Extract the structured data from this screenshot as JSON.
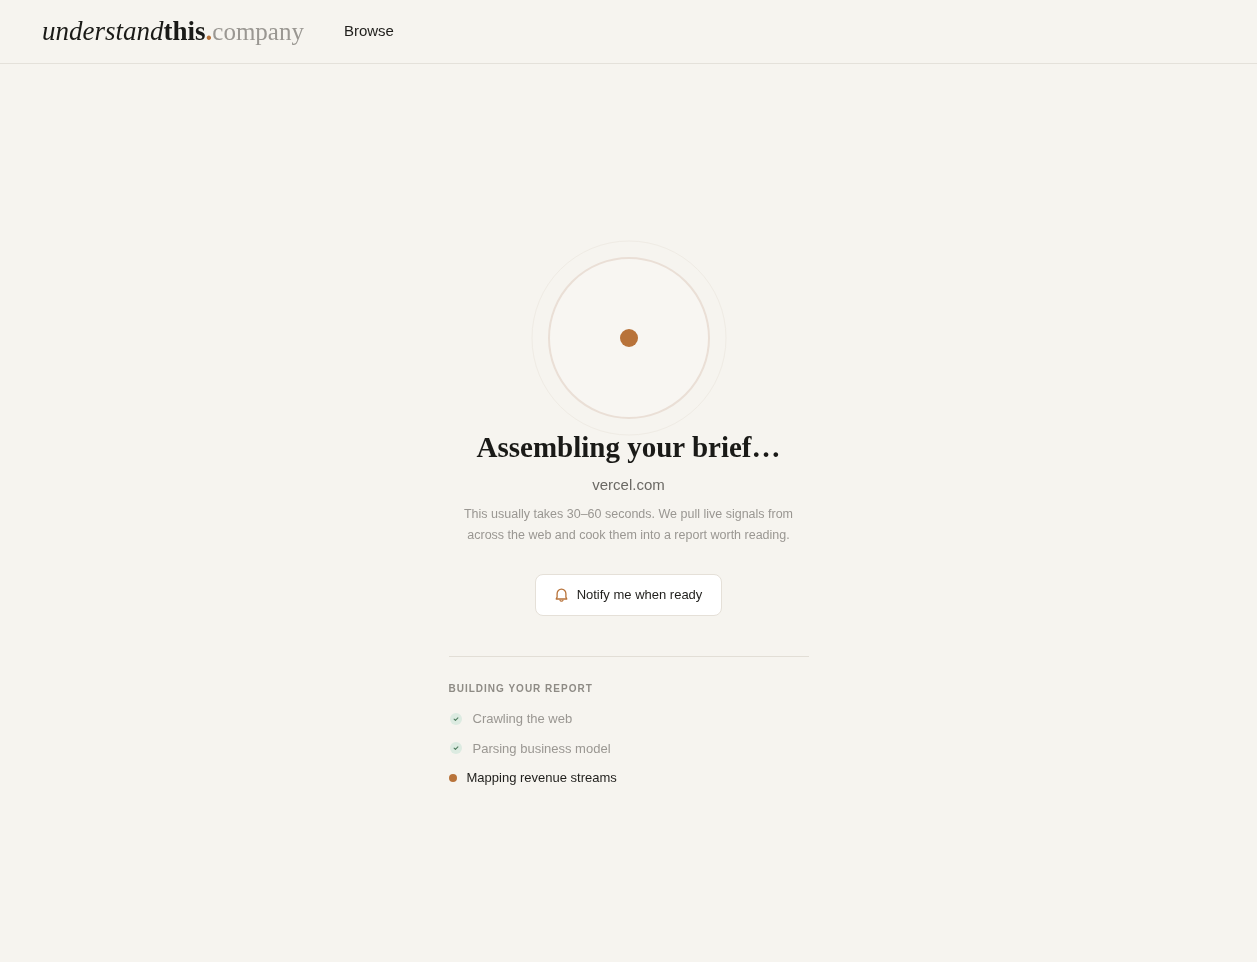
{
  "header": {
    "logo": [
      {
        "text": "understand",
        "kind": "italic"
      },
      {
        "text": "this",
        "kind": "bold"
      },
      {
        "text": ".",
        "kind": "accent"
      },
      {
        "text": "company",
        "kind": "muted"
      }
    ],
    "nav": [
      {
        "label": "Browse"
      }
    ]
  },
  "loader": {
    "title": "Assembling your brief…",
    "domain": "vercel.com",
    "description": "This usually takes 30–60 seconds. We pull live signals from across the web and cook them into a report worth reading.",
    "notify_button": {
      "label": "Notify me when ready"
    }
  },
  "progress": {
    "heading": "BUILDING YOUR REPORT",
    "steps": [
      {
        "label": "Crawling the web",
        "done": true
      },
      {
        "label": "Parsing business model",
        "done": true
      },
      {
        "label": "Mapping revenue streams",
        "done": false
      }
    ]
  }
}
